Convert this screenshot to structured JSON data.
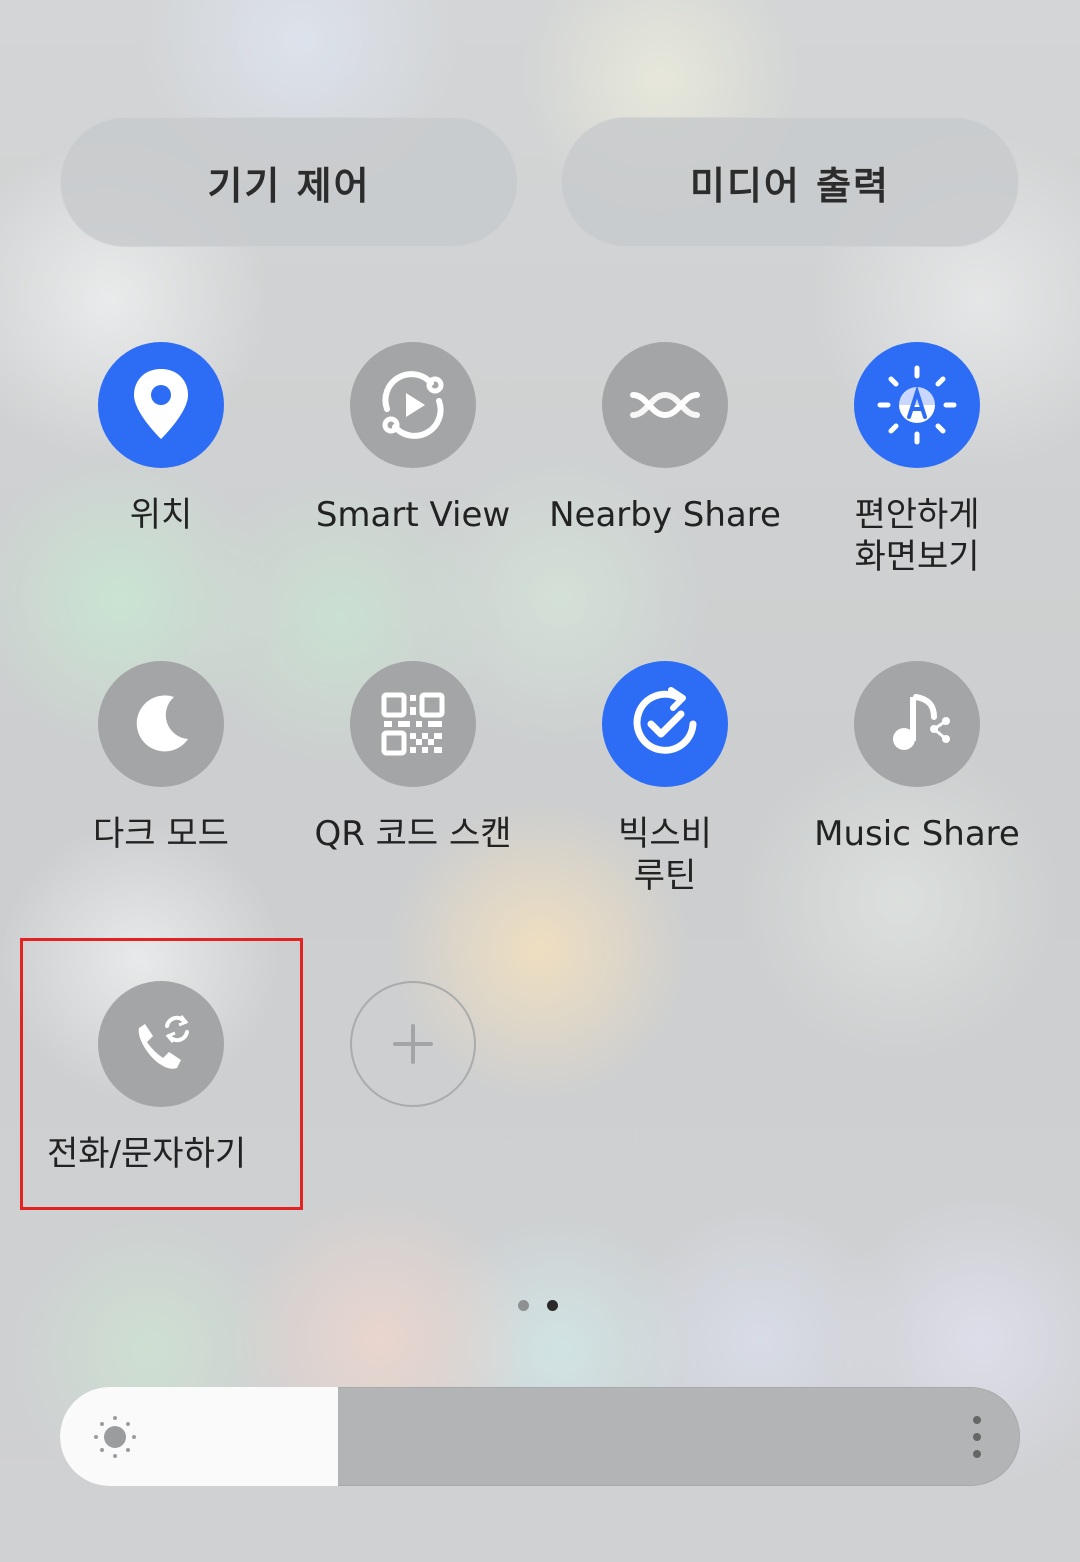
{
  "top_buttons": {
    "device_control": "기기 제어",
    "media_output": "미디어 출력"
  },
  "tiles": [
    {
      "label": "위치",
      "icon": "location-pin-icon",
      "state": "on"
    },
    {
      "label": "Smart View",
      "icon": "smart-view-icon",
      "state": "off"
    },
    {
      "label": "Nearby Share",
      "icon": "nearby-share-icon",
      "state": "off"
    },
    {
      "label": "편안하게\n화면보기",
      "icon": "eye-comfort-icon",
      "state": "on"
    },
    {
      "label": "다크 모드",
      "icon": "moon-icon",
      "state": "off"
    },
    {
      "label": "QR 코드 스캔",
      "icon": "qr-code-icon",
      "state": "off"
    },
    {
      "label": "빅스비\n루틴",
      "icon": "bixby-routines-icon",
      "state": "on"
    },
    {
      "label": "Music Share",
      "icon": "music-share-icon",
      "state": "off"
    },
    {
      "label": "전화/문자하기",
      "icon": "call-text-other-devices-icon",
      "state": "off"
    }
  ],
  "add_tile": {
    "icon": "add-icon"
  },
  "page_indicator": {
    "total": 2,
    "current": 2
  },
  "brightness": {
    "level": 0.29
  },
  "colors": {
    "accent": "#2d6df6",
    "tile_off": "#a3a5a6",
    "highlight": "#e32222"
  }
}
